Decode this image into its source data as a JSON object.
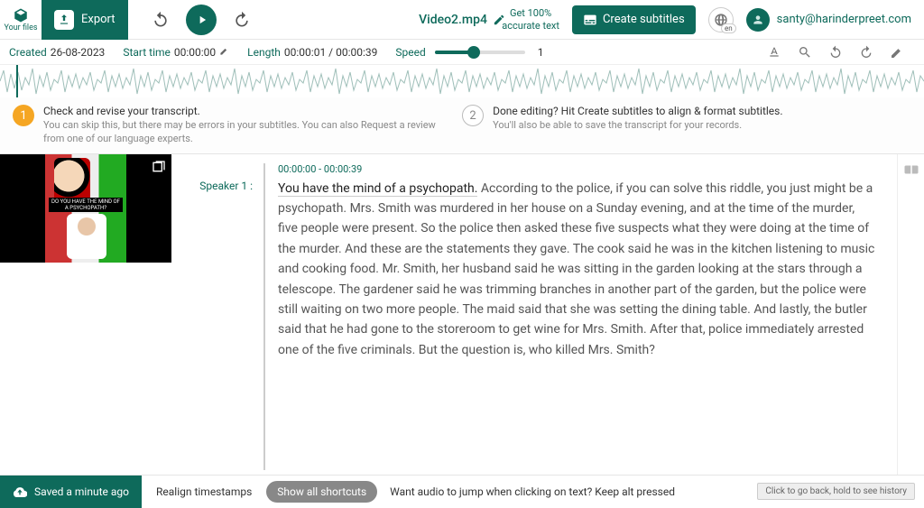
{
  "topbar": {
    "files_label": "Your files",
    "export_label": "Export",
    "video_title": "Video2.mp4",
    "accurate_line1": "Get 100%",
    "accurate_line2": "accurate text",
    "create_subtitles": "Create subtitles",
    "lang_tag": "en",
    "user_email": "santy@harinderpreet.com"
  },
  "meta": {
    "created_label": "Created",
    "created_value": "26-08-2023",
    "start_label": "Start time",
    "start_value": "00:00:00",
    "length_label": "Length",
    "length_value": "00:00:01 / 00:00:39",
    "speed_label": "Speed",
    "speed_value": "1"
  },
  "guidance": {
    "step1_title": "Check and revise your transcript.",
    "step1_sub": "You can skip this, but there may be errors in your subtitles. You can also Request a review from one of our language experts.",
    "step2_title": "Done editing? Hit Create subtitles to align & format subtitles.",
    "step2_sub": "You'll also be able to save the transcript for your records."
  },
  "transcript": {
    "speaker": "Speaker 1",
    "timestamp": "00:00:00 - 00:00:39",
    "lead": "You have the mind of a psychopath.",
    "rest": " According to the police, if you can solve this riddle, you just might be a psychopath. Mrs. Smith was murdered in her house on a Sunday evening, and at the time of the murder, five people were present. So the police then asked these five suspects what they were doing at the time of the murder. And these are the statements they gave. The cook said he was in the kitchen listening to music and cooking food. Mr. Smith, her husband said he was sitting in the garden looking at the stars through a telescope. The gardener said he was trimming branches in another part of the garden, but the police were still waiting on two more people. The maid said that she was setting the dining table. And lastly, the butler said that he had gone to the storeroom to get wine for Mrs. Smith. After that, police immediately arrested one of the five criminals. But the question is, who killed Mrs. Smith?",
    "thumb_caption": "DO YOU HAVE THE MIND OF A PSYCHOPATH?"
  },
  "bottom": {
    "saved": "Saved a minute ago",
    "realign": "Realign timestamps",
    "shortcuts": "Show all shortcuts",
    "hint": "Want audio to jump when clicking on text? Keep alt pressed",
    "history": "Click to go back, hold to see history"
  }
}
